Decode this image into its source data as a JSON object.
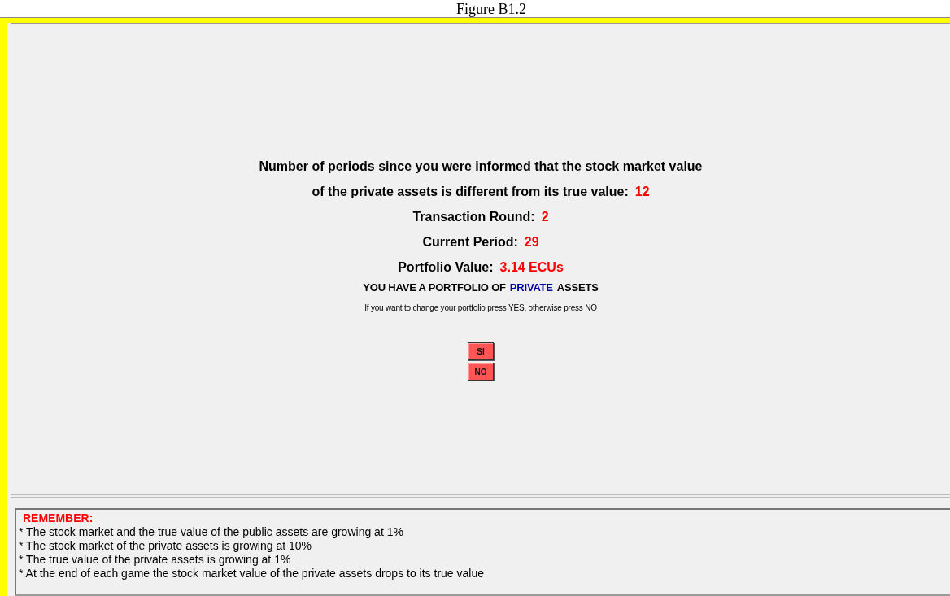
{
  "caption": "Figure B1.2",
  "info_lines": [
    {
      "label": "Number of periods since you were informed that the stock market value"
    },
    {
      "label": "of the private assets is different from its true value:",
      "value": "12"
    },
    {
      "label": "Transaction Round:",
      "value": "2"
    },
    {
      "label": "Current Period:",
      "value": "29"
    },
    {
      "label": "Portfolio Value:",
      "value": "3.14 ECUs"
    }
  ],
  "portfolio_notice": {
    "before": "YOU HAVE A PORTFOLIO OF",
    "highlight": "PRIVATE",
    "after": "ASSETS"
  },
  "instruction": "If you want to change your portfolio press YES, otherwise press NO",
  "buttons": [
    "SI",
    "NO"
  ],
  "remember": {
    "title": "REMEMBER:",
    "items": [
      "* The stock market and the true value of the public assets are growing at 1%",
      "* The stock market of the private assets is growing at 10%",
      "* The true value of the private assets is growing at 1%",
      "* At the end of each game the stock market value of the private assets drops to its true value"
    ]
  }
}
